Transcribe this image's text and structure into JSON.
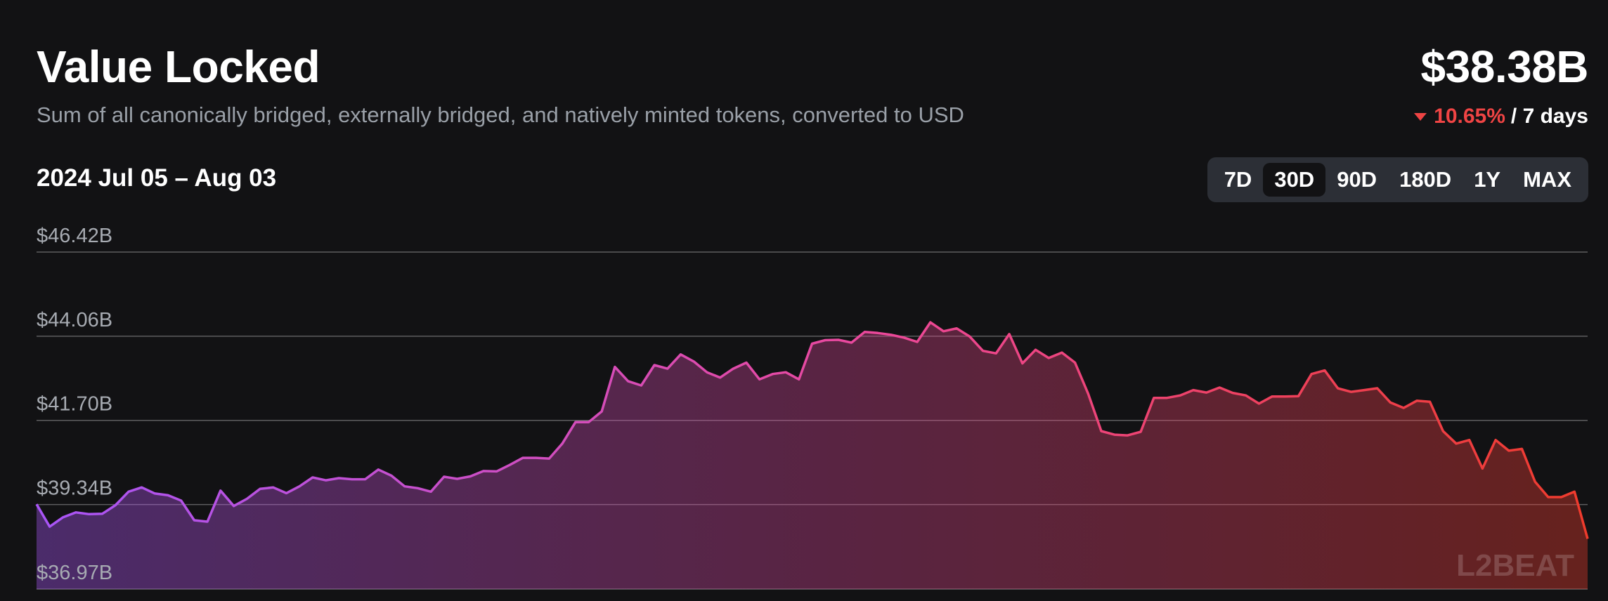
{
  "header": {
    "title": "Value Locked",
    "subtitle": "Sum of all canonically bridged, externally bridged, and natively minted tokens, converted to USD",
    "value": "$38.38B",
    "change_pct": "10.65%",
    "change_period": "/ 7 days",
    "change_direction_icon": "triangle-down-icon"
  },
  "date_range": "2024 Jul 05 – Aug 03",
  "range_options": [
    "7D",
    "30D",
    "90D",
    "180D",
    "1Y",
    "MAX"
  ],
  "range_selected": "30D",
  "watermark": "L2BEAT",
  "colors": {
    "background": "#121214",
    "negative": "#ef4444",
    "gradient_start": "#a855f7",
    "gradient_mid": "#ec4899",
    "gradient_end": "#ef3b2c"
  },
  "chart_data": {
    "type": "area",
    "title": "Value Locked",
    "xlabel": "",
    "ylabel": "",
    "x_start": "2024-07-05",
    "x_end": "2024-08-03",
    "ylim": [
      36.97,
      46.42
    ],
    "y_ticks": [
      "$46.42B",
      "$44.06B",
      "$41.70B",
      "$39.34B",
      "$36.97B"
    ],
    "y_tick_values": [
      46.42,
      44.06,
      41.7,
      39.34,
      36.97
    ],
    "grid": true,
    "legend": "none",
    "series": [
      {
        "values": [
          39.35,
          38.72,
          38.98,
          39.12,
          39.07,
          39.08,
          39.32,
          39.7,
          39.82,
          39.65,
          39.6,
          39.45,
          38.9,
          38.86,
          39.73,
          39.3,
          39.5,
          39.78,
          39.82,
          39.66,
          39.85,
          40.1,
          40.02,
          40.08,
          40.05,
          40.05,
          40.32,
          40.15,
          39.85,
          39.8,
          39.7,
          40.12,
          40.06,
          40.13,
          40.28,
          40.27,
          40.45,
          40.65,
          40.65,
          40.63,
          41.05,
          41.65,
          41.65,
          41.95,
          43.2,
          42.8,
          42.68,
          43.25,
          43.15,
          43.55,
          43.35,
          43.05,
          42.9,
          43.15,
          43.32,
          42.85,
          43.0,
          43.05,
          42.85,
          43.85,
          43.95,
          43.96,
          43.88,
          44.18,
          44.15,
          44.1,
          44.02,
          43.9,
          44.45,
          44.2,
          44.28,
          44.05,
          43.65,
          43.58,
          44.12,
          43.3,
          43.68,
          43.45,
          43.6,
          43.32,
          42.45,
          41.4,
          41.3,
          41.28,
          41.38,
          42.33,
          42.33,
          42.4,
          42.55,
          42.48,
          42.62,
          42.47,
          42.4,
          42.17,
          42.37,
          42.37,
          42.38,
          43.0,
          43.1,
          42.6,
          42.5,
          42.55,
          42.6,
          42.2,
          42.05,
          42.25,
          42.22,
          41.4,
          41.05,
          41.15,
          40.35,
          41.15,
          40.85,
          40.9,
          39.98,
          39.55,
          39.55,
          39.7,
          38.38
        ]
      }
    ]
  }
}
